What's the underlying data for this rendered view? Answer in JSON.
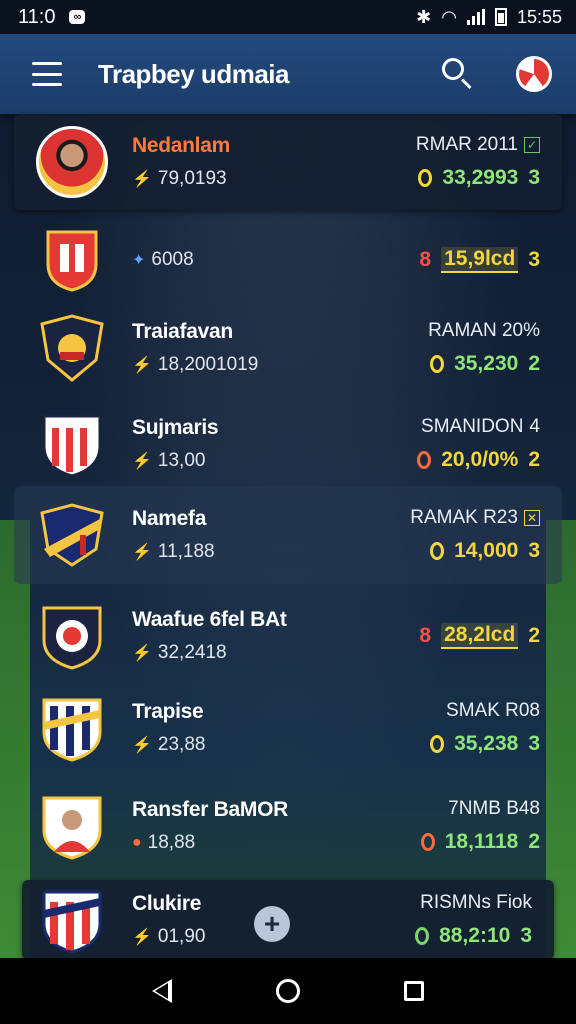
{
  "status_bar": {
    "time": "11:0",
    "badge": "∞",
    "right_time": "15:55"
  },
  "app_bar": {
    "title": "Trapbey udmaia"
  },
  "rows": [
    {
      "name": "Nedanlam",
      "sub": "79,0193",
      "stat_top": "RMAR 2011",
      "stat_bot": "33,2993",
      "rank": "3"
    },
    {
      "name": "",
      "sub": "6008",
      "stat_top": "",
      "red": "8",
      "stat_bot": "15,9lcd",
      "rank": "3"
    },
    {
      "name": "Traiafavan",
      "sub": "18,2001019",
      "stat_top": "RAMAN 20%",
      "stat_bot": "35,230",
      "rank": "2"
    },
    {
      "name": "Sujmaris",
      "sub": "13,00",
      "stat_top": "SMANIDON",
      "stat_top_extra": "4",
      "stat_bot": "20,0/0%",
      "rank": "2"
    },
    {
      "name": "Namefa",
      "sub": "11,188",
      "stat_top": "RAMAK R23",
      "stat_bot": "14,000",
      "rank": "3"
    },
    {
      "name": "Waafue 6fel BAt",
      "sub": "32,2418",
      "stat_top": "",
      "red": "8",
      "stat_bot": "28,2lcd",
      "rank": "2"
    },
    {
      "name": "Trapise",
      "sub": "23,88",
      "stat_top": "SMAK R08",
      "stat_bot": "35,238",
      "rank": "3"
    },
    {
      "name": "Ransfer BaMOR",
      "sub": "18,88",
      "stat_top": "7NMB B48",
      "stat_bot": "18,1118",
      "rank": "2"
    },
    {
      "name": "Clukire",
      "sub": "01,90",
      "stat_top": "RISMNs Fiok",
      "stat_bot": "88,2:10",
      "rank": "3",
      "fab": "+"
    }
  ],
  "colors": {
    "appbar": "#234a7e",
    "accent_green": "#8ee57a",
    "accent_yellow": "#f2d63c",
    "accent_red": "#ff4d4d"
  },
  "icons": [
    "menu-icon",
    "search-icon",
    "app-logo-icon",
    "back-icon",
    "home-icon",
    "recents-icon"
  ]
}
